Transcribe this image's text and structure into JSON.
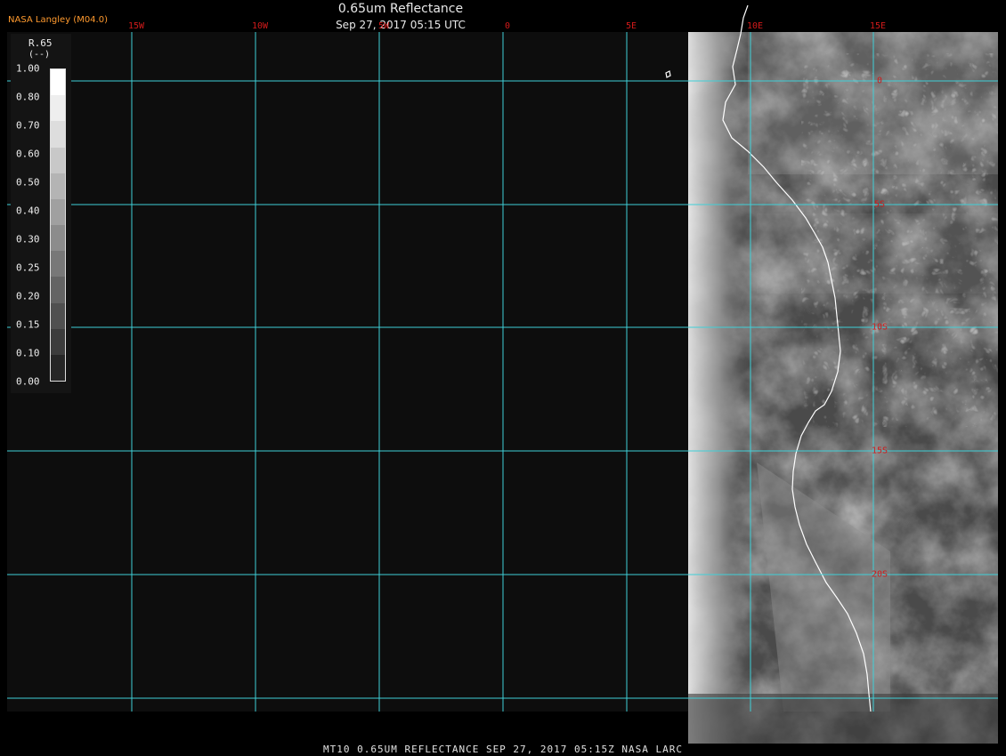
{
  "header": {
    "credit": "NASA Langley (M04.0)",
    "title": "0.65um Reflectance",
    "subtitle": "Sep 27, 2017 05:15 UTC"
  },
  "grid": {
    "longitude_labels": [
      "15W",
      "10W",
      "5W",
      "0",
      "5E",
      "10E",
      "15E"
    ],
    "latitude_labels": [
      "0",
      "5S",
      "10S",
      "15S",
      "20S"
    ],
    "line_color": "#3fd0d8",
    "label_color": "#d21a1a"
  },
  "legend": {
    "variable": "R.65",
    "units": "(--)",
    "ticks": [
      "1.00",
      "0.80",
      "0.70",
      "0.60",
      "0.50",
      "0.40",
      "0.30",
      "0.25",
      "0.20",
      "0.15",
      "0.10",
      "0.00"
    ],
    "colors": [
      "#ffffff",
      "#eeeeee",
      "#dddddd",
      "#c8c8c8",
      "#b4b4b4",
      "#a0a0a0",
      "#8c8c8c",
      "#787878",
      "#646464",
      "#505050",
      "#3c3c3c",
      "#262626"
    ]
  },
  "footer": {
    "text": "MT10  0.65UM REFLECTANCE   SEP 27, 2017 05:15Z   NASA LARC"
  }
}
